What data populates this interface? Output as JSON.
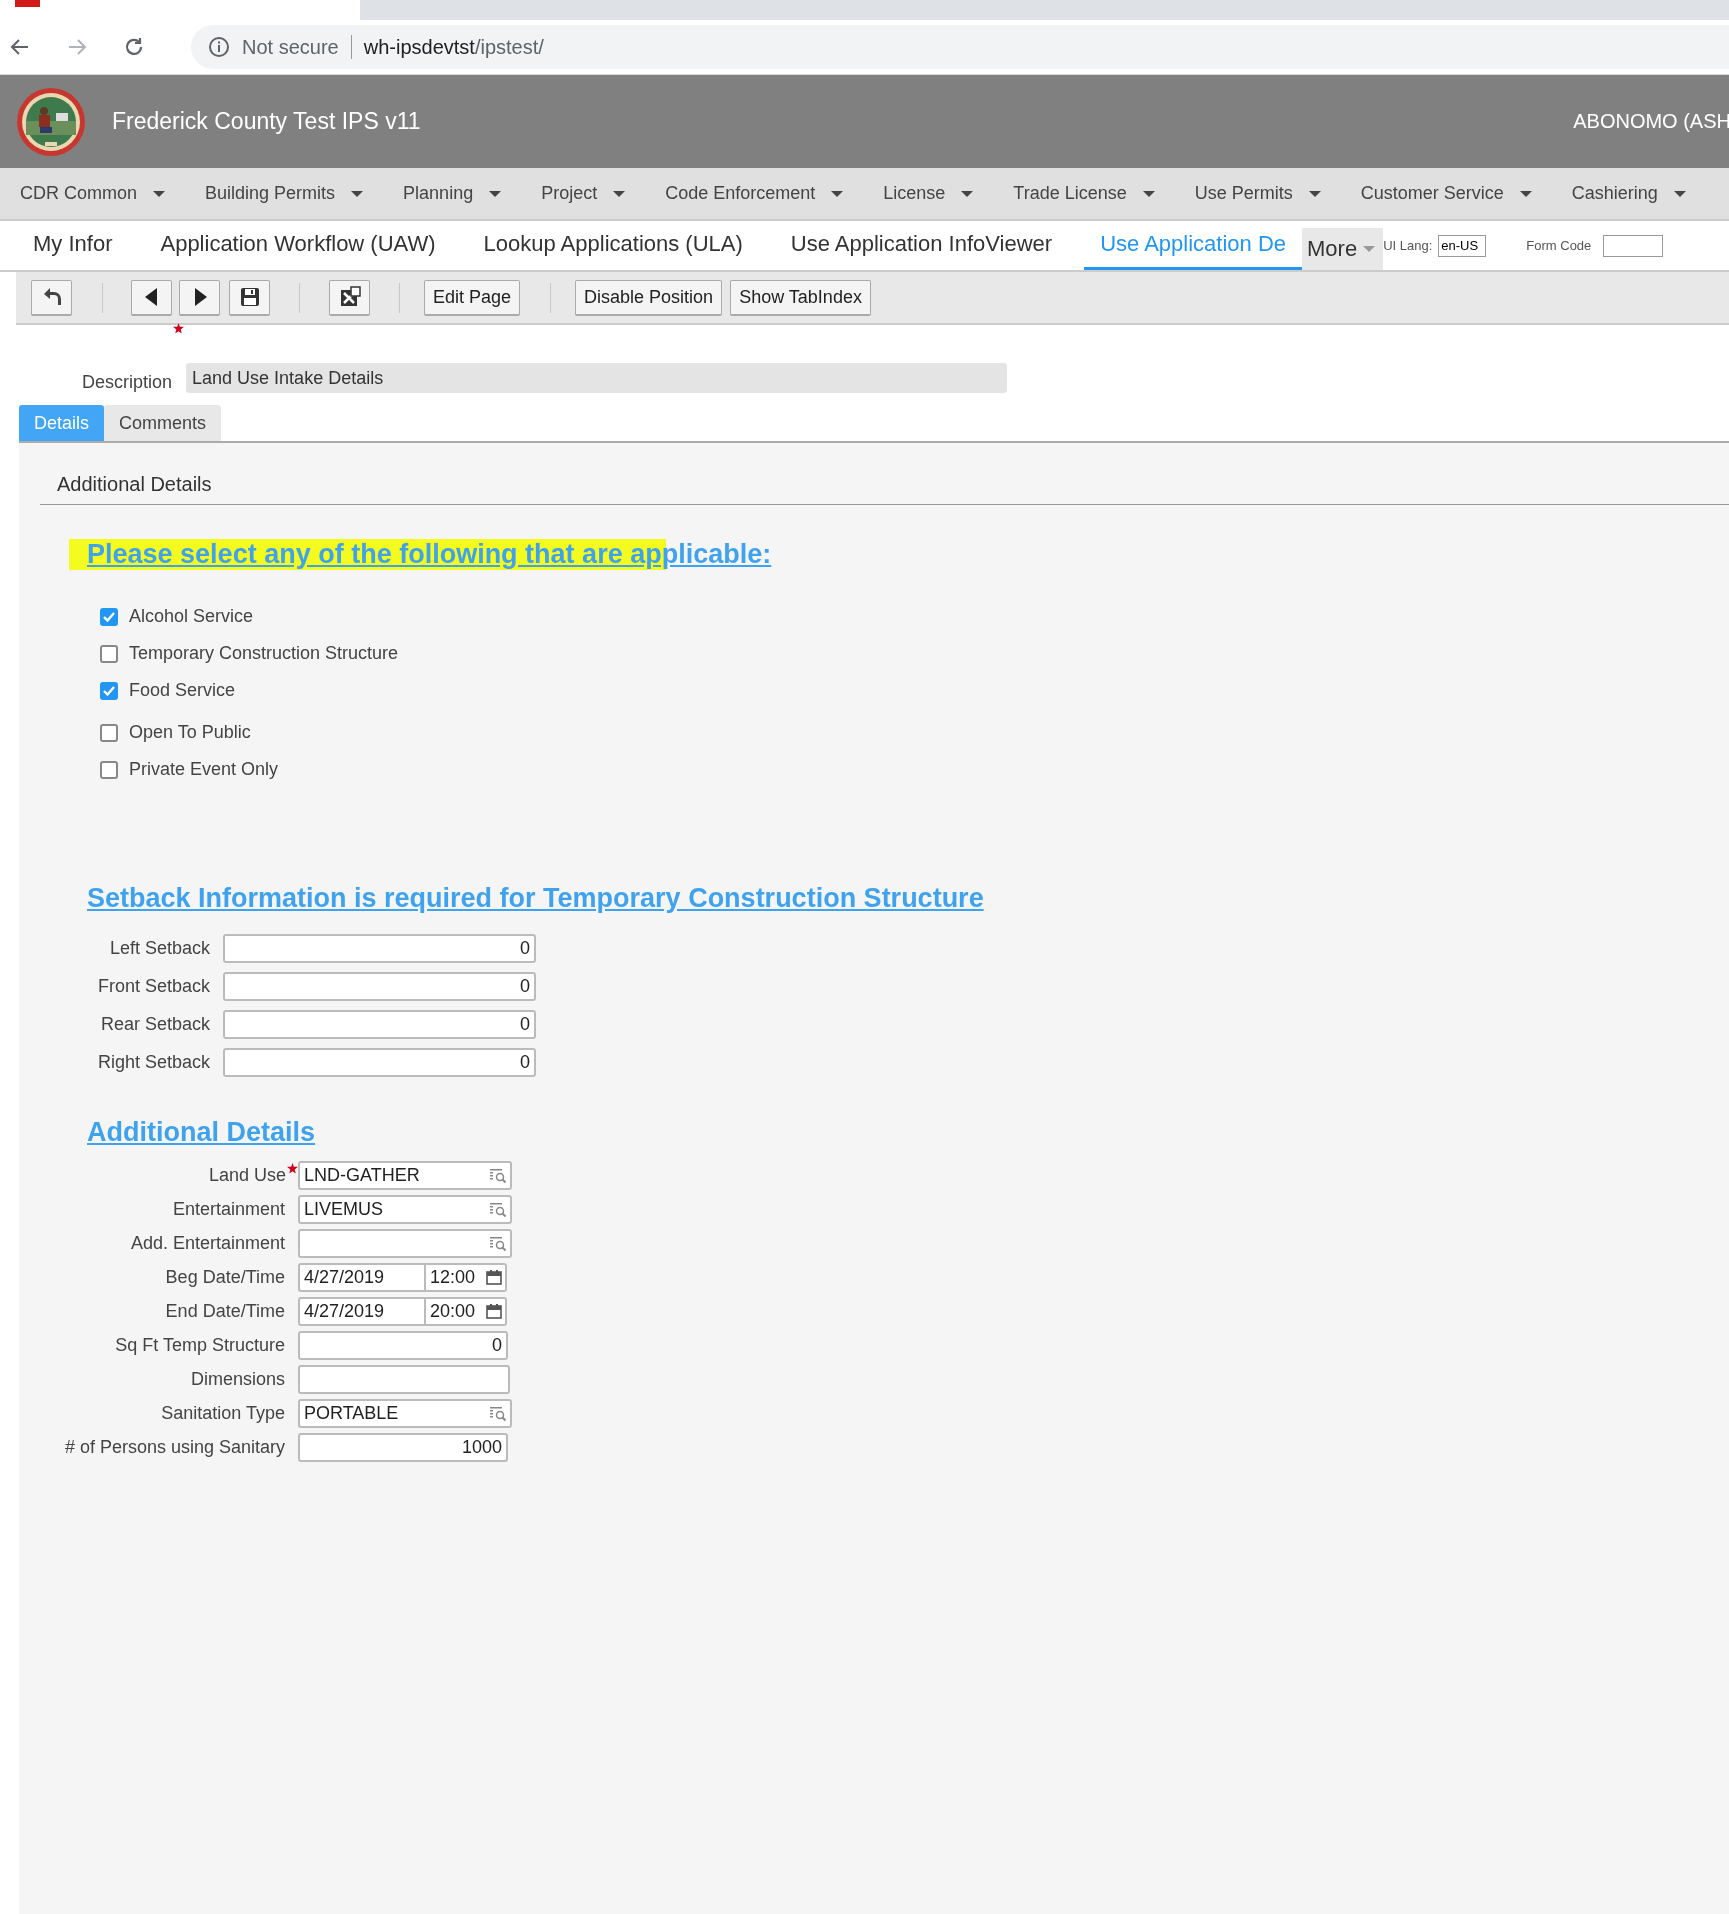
{
  "browser": {
    "security_label": "Not secure",
    "url_host": "wh-ipsdevtst",
    "url_path": "/ipstest/"
  },
  "header": {
    "title": "Frederick County Test IPS v11",
    "user": "ABONOMO (ASH"
  },
  "menu": [
    "CDR Common",
    "Building Permits",
    "Planning",
    "Project",
    "Code Enforcement",
    "License",
    "Trade License",
    "Use Permits",
    "Customer Service",
    "Cashiering"
  ],
  "page_tabs": [
    {
      "label": "My Infor",
      "selected": false
    },
    {
      "label": "Application Workflow (UAW)",
      "selected": false
    },
    {
      "label": "Lookup Applications (ULA)",
      "selected": false
    },
    {
      "label": "Use Application InfoViewer",
      "selected": false
    },
    {
      "label": "Use Application De",
      "selected": true
    }
  ],
  "more_label": "More",
  "ui_lang": {
    "label": "UI Lang:",
    "value": "en-US"
  },
  "form_code": {
    "label": "Form Code"
  },
  "toolbar_buttons": [
    "Edit Page",
    "Disable Position",
    "Show TabIndex"
  ],
  "description": {
    "label": "Description",
    "required": true,
    "value": "Land Use Intake Details"
  },
  "form_tabs": [
    {
      "label": "Details",
      "selected": true
    },
    {
      "label": "Comments",
      "selected": false
    }
  ],
  "section_title": "Additional Details",
  "applicable": {
    "heading": "Please select any of the following that are applicable:",
    "highlighted": true,
    "options": [
      {
        "label": "Alcohol Service",
        "checked": true
      },
      {
        "label": "Temporary Construction Structure",
        "checked": false
      },
      {
        "label": "Food Service",
        "checked": true
      },
      {
        "label": "Open To Public",
        "checked": false
      },
      {
        "label": "Private Event Only",
        "checked": false
      }
    ]
  },
  "setback": {
    "heading": "Setback Information is required for Temporary Construction Structure",
    "fields": [
      {
        "label": "Left Setback",
        "value": "0"
      },
      {
        "label": "Front Setback",
        "value": "0"
      },
      {
        "label": "Rear Setback",
        "value": "0"
      },
      {
        "label": "Right Setback",
        "value": "0"
      }
    ]
  },
  "additional": {
    "heading": "Additional Details",
    "fields": [
      {
        "kind": "lookup",
        "label": "Land Use",
        "required": true,
        "value": "LND-GATHER"
      },
      {
        "kind": "lookup",
        "label": "Entertainment",
        "required": false,
        "value": "LIVEMUS"
      },
      {
        "kind": "lookup",
        "label": "Add. Entertainment",
        "required": false
      },
      {
        "kind": "datetime",
        "label": "Beg Date/Time",
        "required": false,
        "date": "4/27/2019",
        "time": "12:00"
      },
      {
        "kind": "datetime",
        "label": "End Date/Time",
        "required": false,
        "date": "4/27/2019",
        "time": "20:00"
      },
      {
        "kind": "number",
        "label": "Sq Ft Temp Structure",
        "required": false,
        "value": "0"
      },
      {
        "kind": "text",
        "label": "Dimensions",
        "required": false
      },
      {
        "kind": "lookup",
        "label": "Sanitation Type",
        "required": false,
        "value": "PORTABLE"
      },
      {
        "kind": "number",
        "label": "# of Persons using Sanitary",
        "required": false,
        "value": "1000"
      }
    ]
  }
}
